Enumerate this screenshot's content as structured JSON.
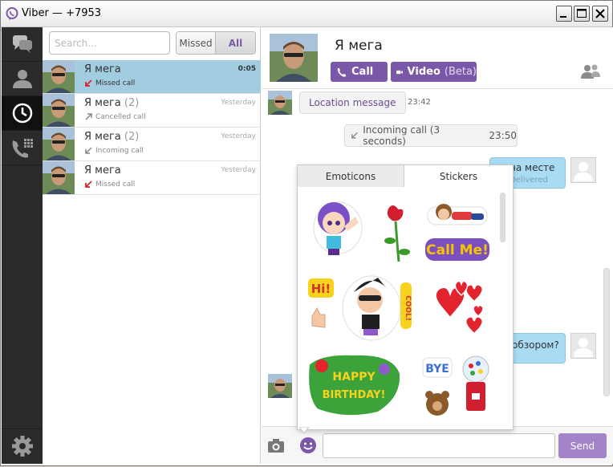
{
  "window": {
    "title": "Viber — +7953"
  },
  "search": {
    "placeholder": "Search..."
  },
  "filter": {
    "missed": "Missed",
    "all": "All"
  },
  "calls": [
    {
      "name": "Я мега",
      "count": "",
      "time": "0:05",
      "status": "Missed call",
      "status_icon": "missed-arrow-icon",
      "selected": true
    },
    {
      "name": "Я мега",
      "count": "(2)",
      "time": "Yesterday",
      "status": "Cancelled call",
      "status_icon": "cancelled-arrow-icon",
      "selected": false
    },
    {
      "name": "Я мега",
      "count": "(2)",
      "time": "Yesterday",
      "status": "Incoming call",
      "status_icon": "incoming-arrow-icon",
      "selected": false
    },
    {
      "name": "Я мега",
      "count": "",
      "time": "Yesterday",
      "status": "Missed call",
      "status_icon": "missed-arrow-icon",
      "selected": false
    }
  ],
  "chat": {
    "contact_name": "Я мега",
    "call_label": "Call",
    "video_label": "Video",
    "video_beta": "(Beta)",
    "location_message": "Location message",
    "location_time": "23:42",
    "incoming_call": "Incoming call (3 seconds)",
    "incoming_time": "23:50",
    "out_msg_1": "на месте",
    "out_msg_1_status": "Delivered",
    "out_msg_2": "обзором?"
  },
  "stickers": {
    "tab_emoticons": "Emoticons",
    "tab_stickers": "Stickers",
    "items": [
      "girl-wave-sticker",
      "rose-sticker",
      "lying-boy-sticker",
      "call-me-sticker",
      "hi-sticker",
      "cool-boy-sticker",
      "hearts-sticker",
      "happy-birthday-sticker",
      "bye-sticker",
      "teddy-bear-sticker",
      "gumball-machine-sticker"
    ],
    "text_call_me": "Call Me!",
    "text_hi": "Hi!",
    "text_cool": "COOL!",
    "text_happy": "HAPPY",
    "text_birthday": "BIRTHDAY!",
    "text_bye": "BYE"
  },
  "composer": {
    "send_label": "Send"
  },
  "colors": {
    "accent": "#7b57a7",
    "selected_row": "#a2cde0",
    "outgoing_bubble": "#a9dcf3",
    "nav_bg": "#2b2b2b"
  }
}
